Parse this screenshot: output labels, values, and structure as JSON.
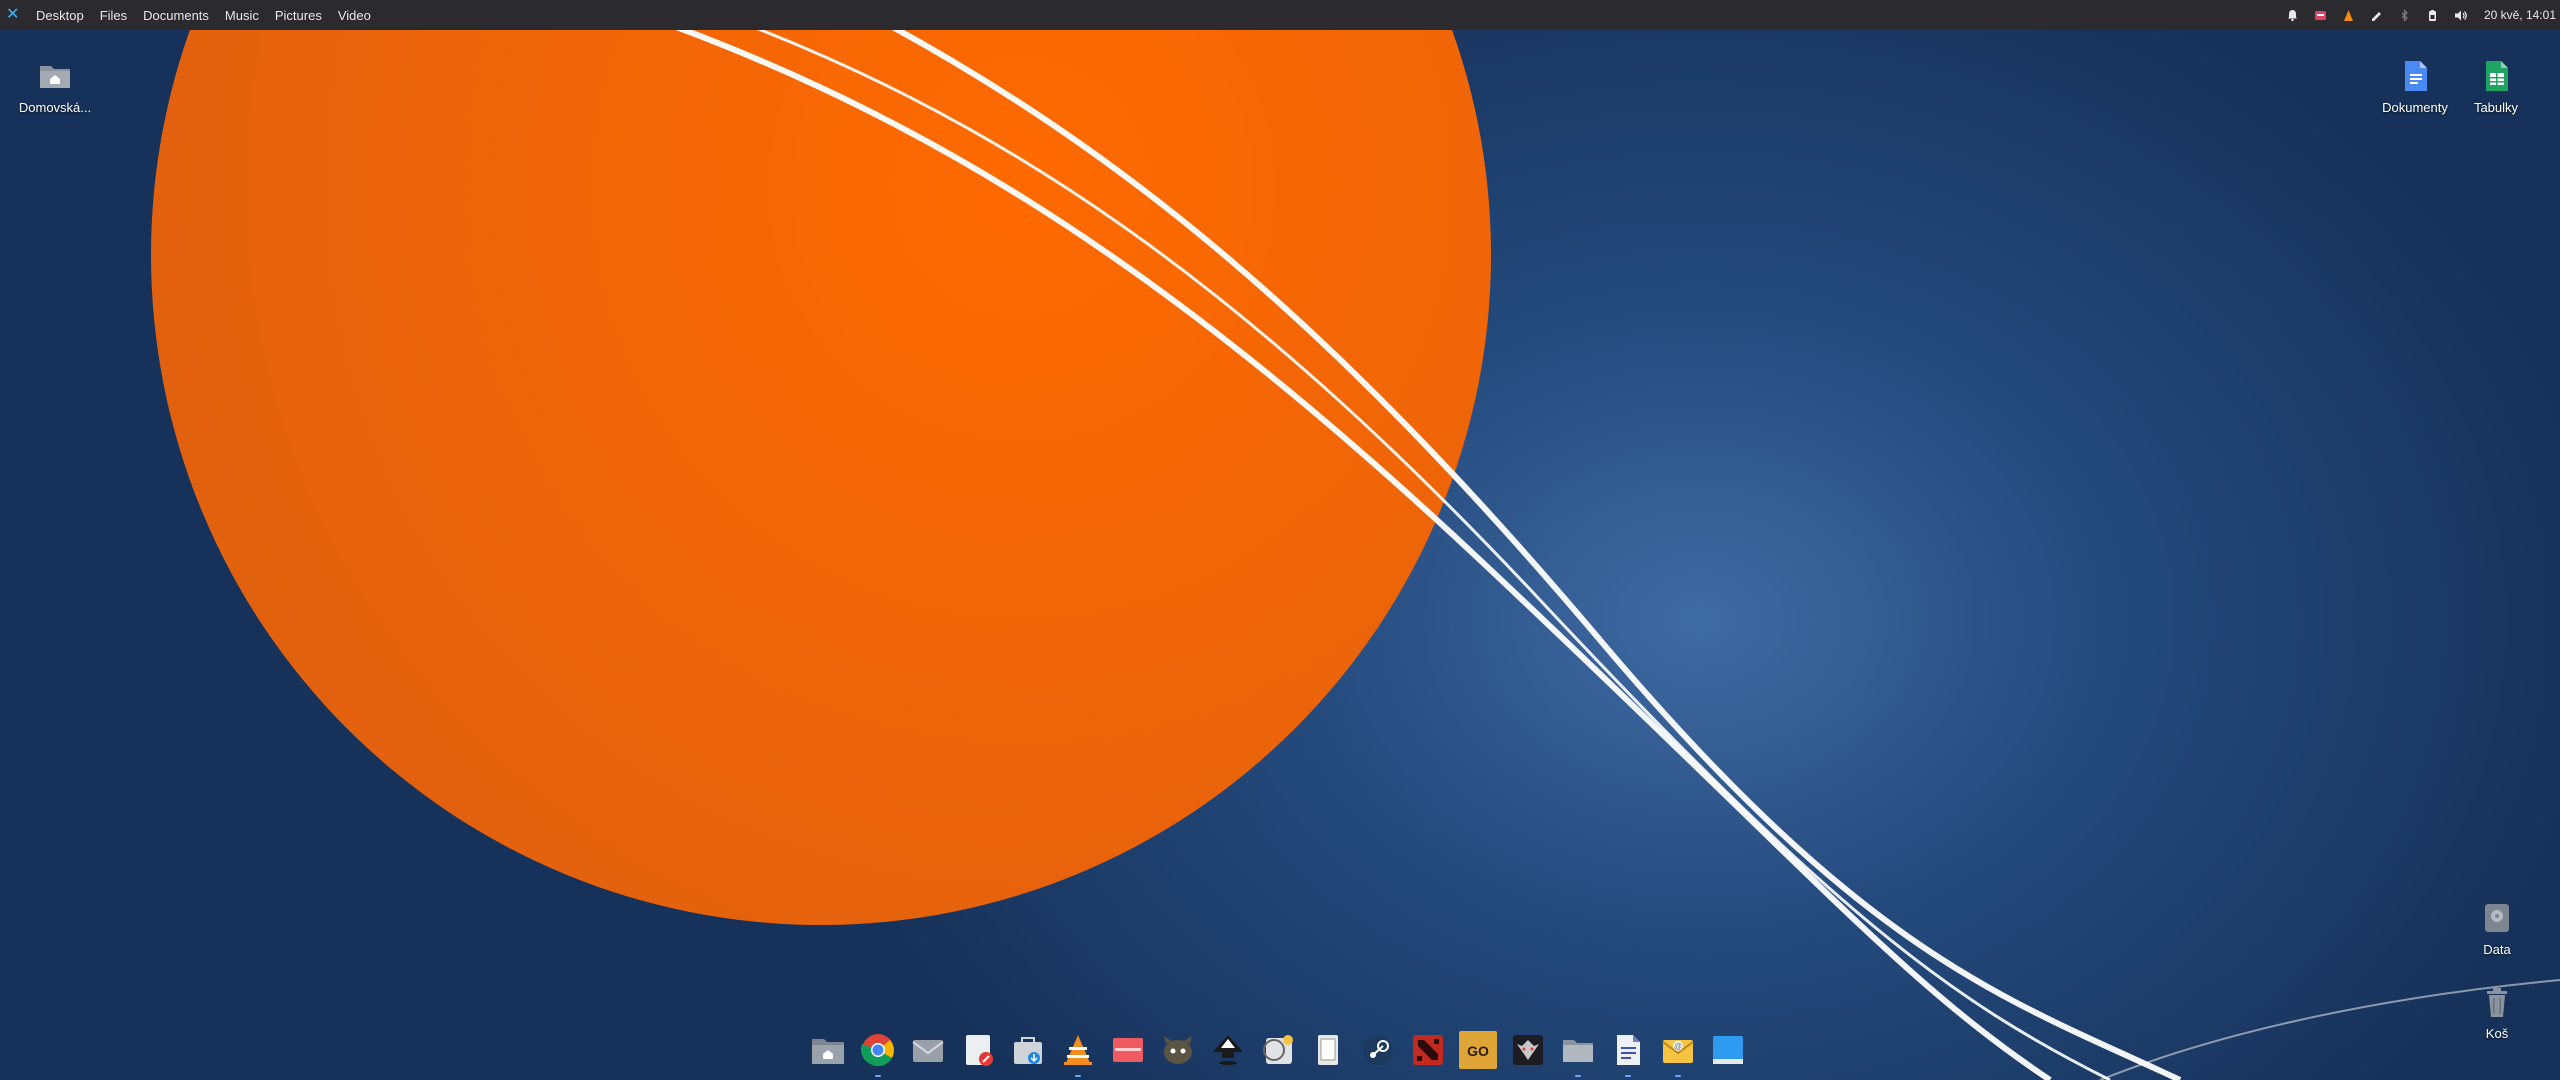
{
  "topbar": {
    "menu": [
      "Desktop",
      "Files",
      "Documents",
      "Music",
      "Pictures",
      "Video"
    ],
    "clock": "20 kvě, 14:01"
  },
  "desktop": {
    "home": "Domovská...",
    "docs": "Dokumenty",
    "sheets": "Tabulky",
    "data": "Data",
    "trash": "Koš"
  },
  "dock": [
    {
      "name": "files-icon"
    },
    {
      "name": "chrome-icon"
    },
    {
      "name": "mail-icon"
    },
    {
      "name": "text-editor-icon"
    },
    {
      "name": "store-icon"
    },
    {
      "name": "vlc-icon"
    },
    {
      "name": "image-viewer-icon"
    },
    {
      "name": "gimp-icon"
    },
    {
      "name": "inkscape-icon"
    },
    {
      "name": "photo-app-icon"
    },
    {
      "name": "document-viewer-icon"
    },
    {
      "name": "steam-icon"
    },
    {
      "name": "dota-icon"
    },
    {
      "name": "csgo-icon"
    },
    {
      "name": "witcher-icon"
    },
    {
      "name": "folder-icon"
    },
    {
      "name": "writer-icon"
    },
    {
      "name": "mail-client-icon"
    },
    {
      "name": "screen-icon"
    }
  ],
  "colors": {
    "panel": "#2b2b2f",
    "accent": "#3cb6ff",
    "orange": "#f06a0c"
  }
}
